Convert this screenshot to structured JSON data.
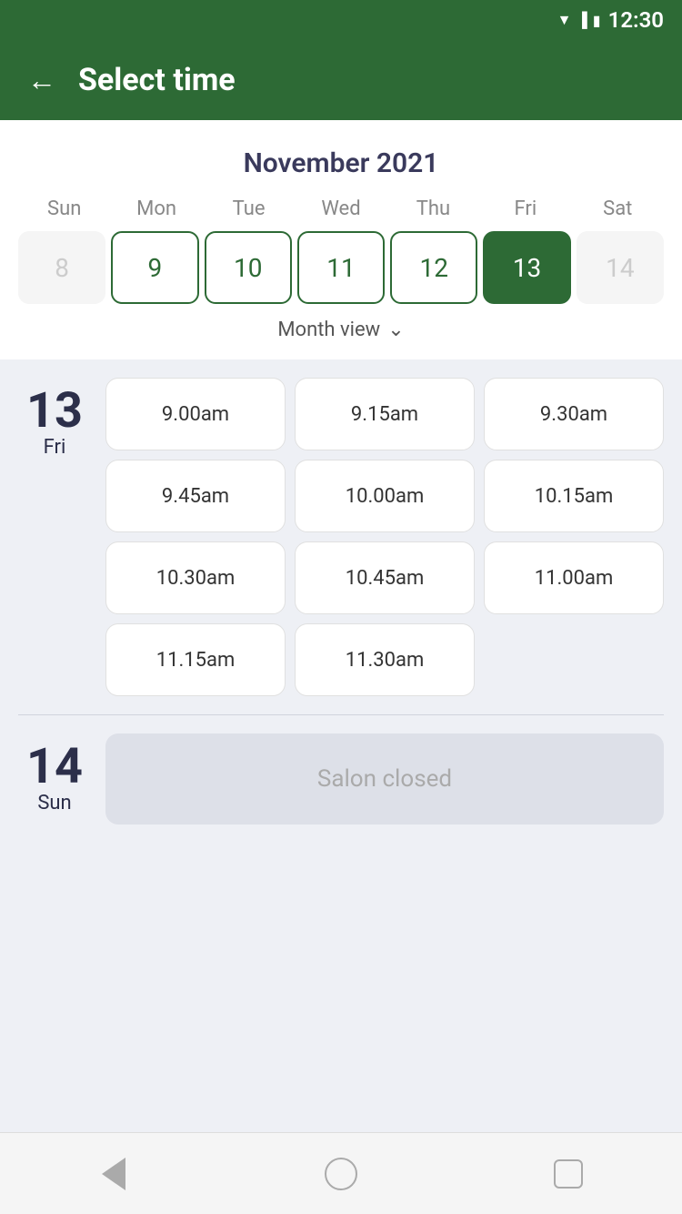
{
  "statusBar": {
    "time": "12:30"
  },
  "header": {
    "title": "Select time",
    "backLabel": "←"
  },
  "calendar": {
    "monthTitle": "November 2021",
    "dayHeaders": [
      "Sun",
      "Mon",
      "Tue",
      "Wed",
      "Thu",
      "Fri",
      "Sat"
    ],
    "days": [
      {
        "num": "8",
        "state": "inactive"
      },
      {
        "num": "9",
        "state": "available"
      },
      {
        "num": "10",
        "state": "available"
      },
      {
        "num": "11",
        "state": "available"
      },
      {
        "num": "12",
        "state": "available"
      },
      {
        "num": "13",
        "state": "selected"
      },
      {
        "num": "14",
        "state": "inactive"
      }
    ],
    "monthViewLabel": "Month view"
  },
  "timeSection": {
    "day13": {
      "number": "13",
      "name": "Fri",
      "slots": [
        "9.00am",
        "9.15am",
        "9.30am",
        "9.45am",
        "10.00am",
        "10.15am",
        "10.30am",
        "10.45am",
        "11.00am",
        "11.15am",
        "11.30am"
      ]
    },
    "day14": {
      "number": "14",
      "name": "Sun",
      "closedLabel": "Salon closed"
    }
  },
  "navBar": {
    "back": "back",
    "home": "home",
    "recents": "recents"
  }
}
